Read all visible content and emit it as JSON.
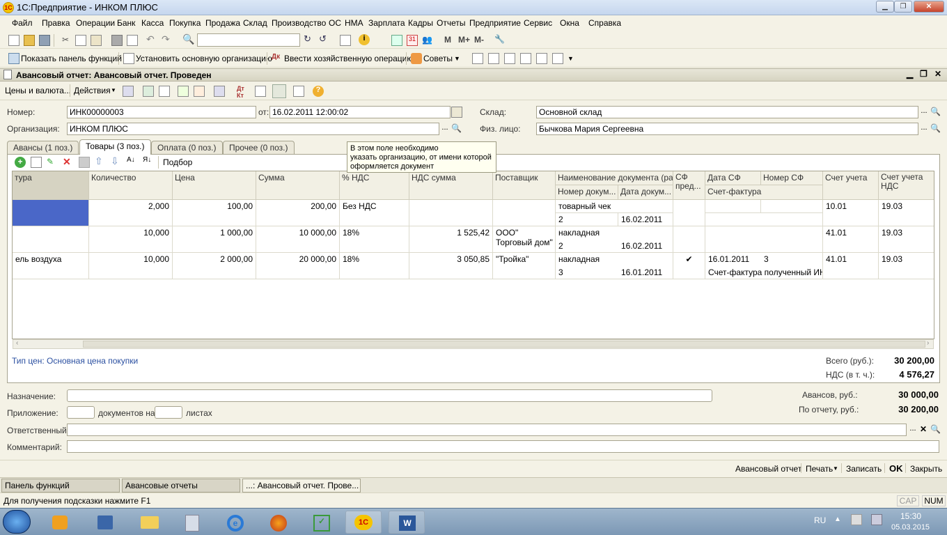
{
  "window": {
    "title": "1С:Предприятие - ИНКОМ ПЛЮС",
    "logo": "1С"
  },
  "menu": [
    "Файл",
    "Правка",
    "Операции",
    "Банк",
    "Касса",
    "Покупка",
    "Продажа",
    "Склад",
    "Производство",
    "ОС",
    "НМА",
    "Зарплата",
    "Кадры",
    "Отчеты",
    "Предприятие",
    "Сервис",
    "Окна",
    "Справка"
  ],
  "toolbar2": {
    "show_panel": "Показать панель функций",
    "set_org": "Установить основную организацию",
    "enter_op": "Ввести хозяйственную операцию",
    "tips": "Советы"
  },
  "doc": {
    "title": "Авансовый отчет: Авансовый отчет. Проведен",
    "toolbar": {
      "prices": "Цены и валюта...",
      "actions": "Действия"
    },
    "number_label": "Номер:",
    "number": "ИНК00000003",
    "date_label": "от:",
    "date": "16.02.2011 12:00:02",
    "org_label": "Организация:",
    "org": "ИНКОМ ПЛЮС",
    "warehouse_label": "Склад:",
    "warehouse": "Основной склад",
    "person_label": "Физ. лицо:",
    "person": "Бычкова Мария Сергеевна"
  },
  "tabs": [
    "Авансы (1 поз.)",
    "Товары (3 поз.)",
    "Оплата (0 поз.)",
    "Прочее (0 поз.)"
  ],
  "tooltip": [
    "В этом поле необходимо",
    "указать организацию, от имени которой",
    "оформляется документ"
  ],
  "grid_toolbar": {
    "pick": "Подбор"
  },
  "columns": {
    "nomen": "тура",
    "qty": "Количество",
    "price": "Цена",
    "sum": "Сумма",
    "vat_pct": "% НДС",
    "vat_sum": "НДС сумма",
    "supplier": "Поставщик",
    "docname": "Наименование документа (ра...",
    "docnum": "Номер докум...",
    "docdate": "Дата докум...",
    "sf": "СФ пред...",
    "sf_date": "Дата СФ",
    "sf_num": "Номер СФ",
    "sf_doc": "Счет-фактура",
    "acc": "Счет учета",
    "acc_vat": "Счет учета НДС"
  },
  "rows": [
    {
      "nomen": "",
      "qty": "2,000",
      "price": "100,00",
      "sum": "200,00",
      "vat_pct": "Без НДС",
      "vat_sum": "",
      "supplier1": "",
      "supplier2": "",
      "docname": "товарный чек",
      "docnum": "2",
      "docdate": "16.02.2011",
      "sf": "",
      "sf_date": "",
      "sf_num": "",
      "sf_doc": "",
      "acc": "10.01",
      "acc_vat": "19.03"
    },
    {
      "nomen": "",
      "qty": "10,000",
      "price": "1 000,00",
      "sum": "10 000,00",
      "vat_pct": "18%",
      "vat_sum": "1 525,42",
      "supplier1": "ООО\"",
      "supplier2": "Торговый дом\"",
      "docname": "накладная",
      "docnum": "2",
      "docdate": "16.02.2011",
      "sf": "",
      "sf_date": "",
      "sf_num": "",
      "sf_doc": "",
      "acc": "41.01",
      "acc_vat": "19.03"
    },
    {
      "nomen": "ель воздуха",
      "qty": "10,000",
      "price": "2 000,00",
      "sum": "20 000,00",
      "vat_pct": "18%",
      "vat_sum": "3 050,85",
      "supplier1": "\"Тройка\"",
      "supplier2": "",
      "docname": "накладная",
      "docnum": "3",
      "docdate": "16.01.2011",
      "sf": "✔",
      "sf_date": "16.01.2011",
      "sf_num": "3",
      "sf_doc": "Счет-фактура полученный ИН...",
      "acc": "41.01",
      "acc_vat": "19.03"
    }
  ],
  "price_type": "Тип цен: Основная цена покупки",
  "totals": {
    "total_label": "Всего (руб.):",
    "total": "30 200,00",
    "vat_label": "НДС (в т. ч.):",
    "vat": "4 576,27"
  },
  "footer": {
    "purpose_label": "Назначение:",
    "attach_label": "Приложение:",
    "docs_on": "документов на",
    "sheets": "листах",
    "resp_label": "Ответственный:",
    "comment_label": "Комментарий:",
    "advances_label": "Авансов, руб.:",
    "advances": "30 000,00",
    "report_label": "По отчету, руб.:",
    "report": "30 200,00"
  },
  "actions": {
    "report": "Авансовый отчет",
    "print": "Печать",
    "save": "Записать",
    "ok": "OK",
    "close": "Закрыть"
  },
  "taskbar": [
    "Панель функций",
    "Авансовые отчеты",
    "...: Авансовый отчет. Прове..."
  ],
  "status": {
    "hint": "Для получения подсказки нажмите F1",
    "cap": "CAP",
    "num": "NUM"
  },
  "tray": {
    "lang": "RU",
    "time": "15:30",
    "date": "05.03.2015"
  },
  "colors": {
    "selection": "#4a67c8",
    "link": "#2a4fa0"
  }
}
